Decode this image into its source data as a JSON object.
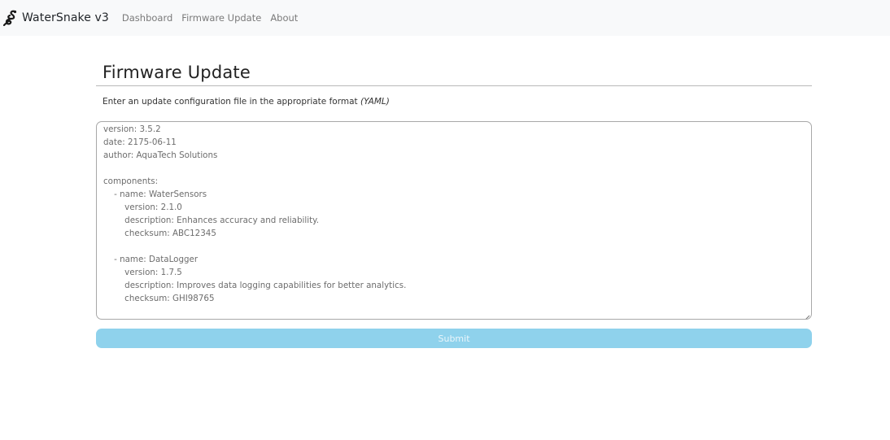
{
  "app": {
    "brand_name": "WaterSnake v3",
    "brand_icon": "snake-icon"
  },
  "nav": {
    "items": [
      {
        "label": "Dashboard"
      },
      {
        "label": "Firmware Update"
      },
      {
        "label": "About"
      }
    ]
  },
  "page": {
    "title": "Firmware Update",
    "instructions_text": "Enter an update configuration file in the appropriate format ",
    "instructions_format": "(YAML)"
  },
  "editor": {
    "value": "version: 3.5.2\ndate: 2175-06-11\nauthor: AquaTech Solutions\n\ncomponents:\n    - name: WaterSensors\n        version: 2.1.0\n        description: Enhances accuracy and reliability.\n        checksum: ABC12345\n\n    - name: DataLogger\n        version: 1.7.5\n        description: Improves data logging capabilities for better analytics.\n        checksum: GHI98765"
  },
  "submit": {
    "label": "Submit",
    "disabled": true
  },
  "colors": {
    "navbar_bg": "#f8f9fa",
    "submit_bg": "#8fd2ec",
    "editor_text": "#6d6d6d"
  }
}
